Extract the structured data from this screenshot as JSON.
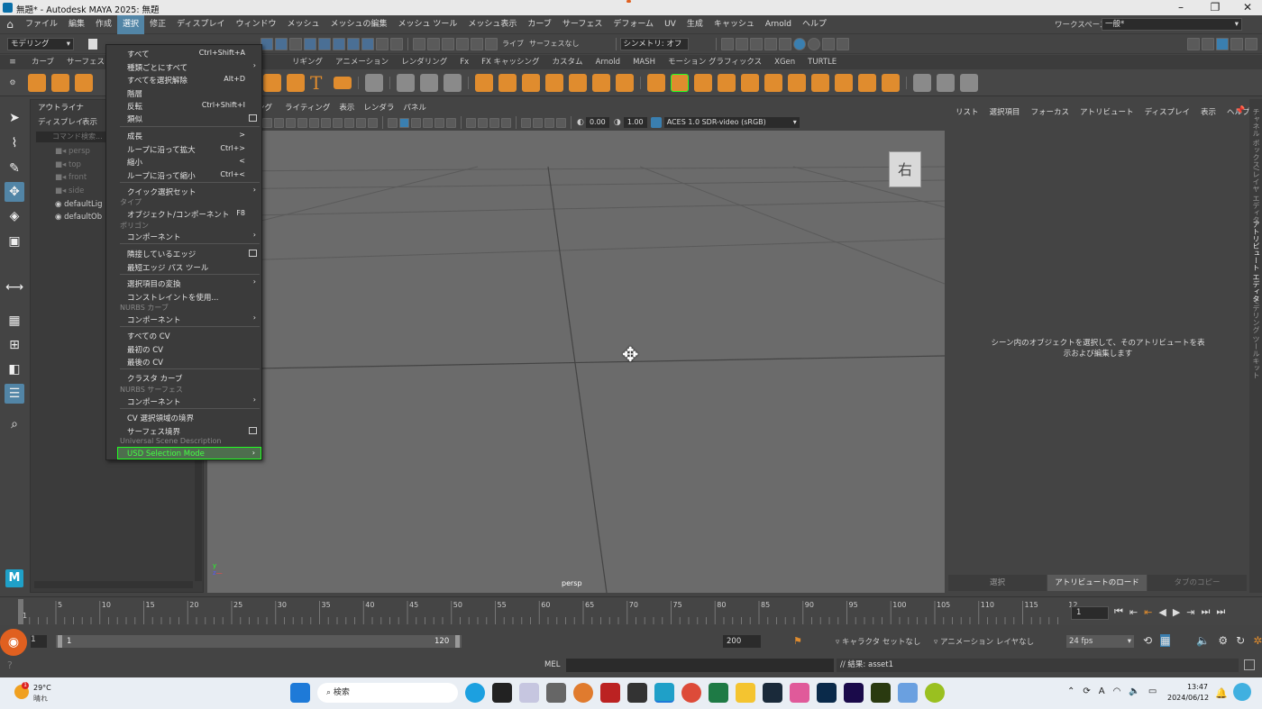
{
  "window": {
    "title": "無題* - Autodesk MAYA 2025: 無題",
    "workspace_label": "ワークスペース:",
    "workspace_value": "一般*"
  },
  "menubar": [
    "ファイル",
    "編集",
    "作成",
    "選択",
    "修正",
    "ディスプレイ",
    "ウィンドウ",
    "メッシュ",
    "メッシュの編集",
    "メッシュ ツール",
    "メッシュ表示",
    "カーブ",
    "サーフェス",
    "デフォーム",
    "UV",
    "生成",
    "キャッシュ",
    "Arnold",
    "ヘルプ"
  ],
  "statusline": {
    "mode": "モデリング",
    "live": "ライブ",
    "live_target": "サーフェスなし",
    "symmetry": "シンメトリ: オフ"
  },
  "shelf_tabs": [
    "カーブ",
    "サーフェス",
    "リギング",
    "アニメーション",
    "レンダリング",
    "Fx",
    "FX キャッシング",
    "カスタム",
    "Arnold",
    "MASH",
    "モーション グラフィックス",
    "XGen",
    "TURTLE"
  ],
  "select_menu": {
    "items": [
      {
        "label": "すべて",
        "shortcut": "Ctrl+Shift+A"
      },
      {
        "label": "種類ごとにすべて",
        "arrow": "›"
      },
      {
        "label": "すべてを選択解除",
        "shortcut": "Alt+D"
      },
      {
        "label": "階層"
      },
      {
        "label": "反転",
        "shortcut": "Ctrl+Shift+I"
      },
      {
        "label": "類似",
        "box": true
      },
      {
        "label": "成長",
        "shortcut": ">"
      },
      {
        "label": "ループに沿って拡大",
        "shortcut": "Ctrl+>"
      },
      {
        "label": "縮小",
        "shortcut": "<"
      },
      {
        "label": "ループに沿って縮小",
        "shortcut": "Ctrl+<"
      },
      {
        "label": "クイック選択セット",
        "arrow": "›"
      },
      {
        "label": "オブジェクト/コンポーネント",
        "shortcut": "F8"
      },
      {
        "label": "コンポーネント",
        "arrow": "›"
      },
      {
        "label": "隣接しているエッジ",
        "box": true
      },
      {
        "label": "最短エッジ パス ツール"
      },
      {
        "label": "選択項目の変換",
        "arrow": "›"
      },
      {
        "label": "コンストレイントを使用..."
      },
      {
        "label": "コンポーネント",
        "arrow": "›"
      },
      {
        "label": "すべての CV"
      },
      {
        "label": "最初の CV"
      },
      {
        "label": "最後の CV"
      },
      {
        "label": "クラスタ カーブ"
      },
      {
        "label": "コンポーネント",
        "arrow": "›"
      },
      {
        "label": "CV 選択領域の境界"
      },
      {
        "label": "サーフェス境界",
        "box": true
      },
      {
        "label": "USD Selection Mode",
        "arrow": "›"
      }
    ],
    "sections": [
      "タイプ",
      "ポリゴン",
      "NURBS カーブ",
      "NURBS サーフェス",
      "Universal Scene Description"
    ]
  },
  "outliner": {
    "title": "アウトライナ",
    "menu": [
      "ディスプレイ",
      "表示"
    ],
    "search_placeholder": "コマンド検索...",
    "items": [
      {
        "label": "persp",
        "dim": true
      },
      {
        "label": "top",
        "dim": true
      },
      {
        "label": "front",
        "dim": true
      },
      {
        "label": "side",
        "dim": true
      },
      {
        "label": "defaultLig",
        "dim": false
      },
      {
        "label": "defaultOb",
        "dim": false
      }
    ]
  },
  "viewport": {
    "menus": [
      "シェーディング",
      "ライティング",
      "表示",
      "レンダラ",
      "パネル"
    ],
    "exposure": "0.00",
    "gamma": "1.00",
    "colorspace": "ACES 1.0 SDR-video (sRGB)",
    "camera": "persp",
    "viewcube": "右"
  },
  "attribute_editor": {
    "menus": [
      "リスト",
      "選択項目",
      "フォーカス",
      "アトリビュート",
      "ディスプレイ",
      "表示",
      "ヘルプ"
    ],
    "message": "シーン内のオブジェクトを選択して、そのアトリビュートを表示および編集します",
    "buttons": [
      "選択",
      "アトリビュートのロード",
      "タブのコピー"
    ],
    "side_tabs": [
      "チャネル ボックス/レイヤ エディタ",
      "アトリビュート エディタ",
      "モデリング ツールキット"
    ]
  },
  "timeline": {
    "ticks": [
      "1",
      "5",
      "10",
      "15",
      "20",
      "25",
      "30",
      "35",
      "40",
      "45",
      "50",
      "55",
      "60",
      "65",
      "70",
      "75",
      "80",
      "85",
      "90",
      "95",
      "100",
      "105",
      "110",
      "115",
      "12"
    ],
    "current_frame": "1"
  },
  "range": {
    "start": "1",
    "range_start": "1",
    "range_end": "120",
    "end": "200",
    "character_set": "キャラクタ セットなし",
    "anim_layer": "アニメーション レイヤなし",
    "fps": "24 fps"
  },
  "cmdline": {
    "lang": "MEL",
    "result": "// 結果: asset1"
  },
  "taskbar": {
    "weather_temp": "29°C",
    "weather_desc": "晴れ",
    "search": "検索",
    "time": "13:47",
    "date": "2024/06/12",
    "input_mode": "A"
  }
}
